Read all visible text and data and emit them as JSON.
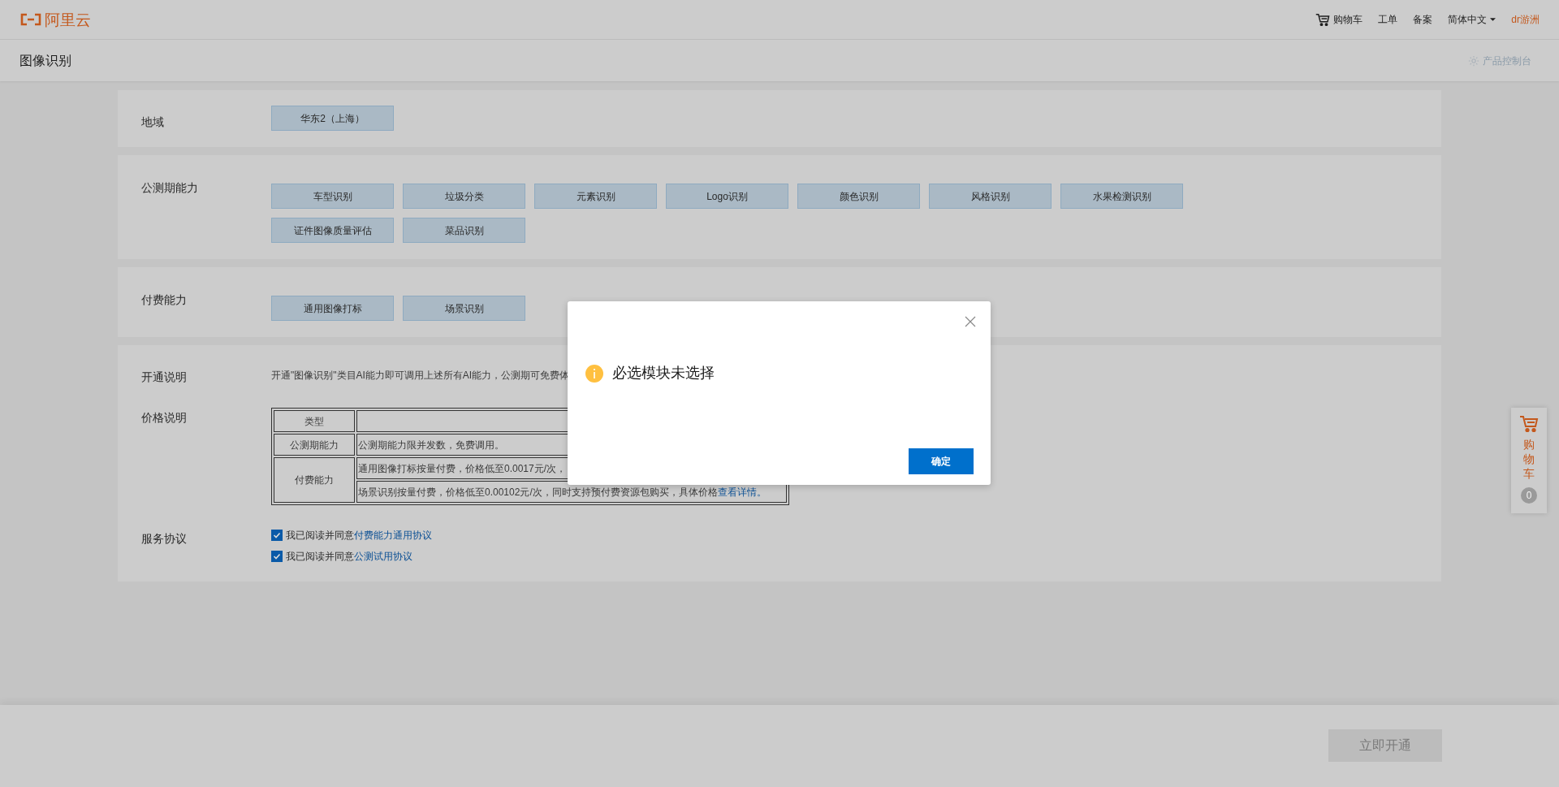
{
  "header": {
    "logo": "阿里云",
    "nav": [
      {
        "kind": "cart",
        "label": "购物车"
      },
      {
        "kind": "link",
        "label": "工单"
      },
      {
        "kind": "link",
        "label": "备案"
      },
      {
        "kind": "dropdown",
        "label": "简体中文"
      },
      {
        "kind": "user",
        "label": "dr游洲"
      }
    ]
  },
  "subheader": {
    "title": "图像识别",
    "console": "产品控制台"
  },
  "sections": [
    {
      "label": "地域",
      "options": [
        {
          "label": "华东2（上海）",
          "selected": false
        }
      ]
    },
    {
      "label": "公测期能力",
      "options": [
        {
          "label": "车型识别",
          "selected": false
        },
        {
          "label": "垃圾分类",
          "selected": false
        },
        {
          "label": "元素识别",
          "selected": false
        },
        {
          "label": "Logo识别",
          "selected": false
        },
        {
          "label": "颜色识别",
          "selected": false
        },
        {
          "label": "风格识别",
          "selected": false
        },
        {
          "label": "水果检测识别",
          "selected": false
        },
        {
          "label": "证件图像质量评估",
          "selected": false
        },
        {
          "label": "菜品识别",
          "selected": false
        }
      ]
    },
    {
      "label": "付费能力",
      "options": [
        {
          "label": "通用图像打标",
          "selected": false
        },
        {
          "label": "场景识别",
          "selected": false
        }
      ]
    }
  ],
  "info": {
    "activation_label": "开通说明",
    "activation_text": "开通\"图像识别\"类目AI能力即可调用上述所有AI能力，公测期可免费体",
    "price_label": "价格说明",
    "price_table": {
      "columns": [
        "类型"
      ],
      "rows": [
        {
          "type": "公测期能力",
          "descriptions": [
            {
              "text": "公测期能力限并发数，免费调用。"
            }
          ]
        },
        {
          "type": "付费能力",
          "descriptions": [
            {
              "text": "通用图像打标按量付费，价格低至0.0017元/次，"
            },
            {
              "text": "场景识别按量付费，价格低至0.00102元/次，同时支持预付费资源包购买，具体价格",
              "link": "查看详情。"
            }
          ]
        }
      ]
    },
    "agreement_label": "服务协议",
    "agreements": [
      {
        "checked": true,
        "text": "我已阅读并同意",
        "link": "付费能力通用协议"
      },
      {
        "checked": true,
        "text": "我已阅读并同意",
        "link": "公测试用协议"
      }
    ]
  },
  "footer": {
    "submit": "立即开通"
  },
  "floating_cart": {
    "label": "购物车",
    "count": "0"
  },
  "dialog": {
    "message": "必选模块未选择",
    "ok": "确定"
  }
}
